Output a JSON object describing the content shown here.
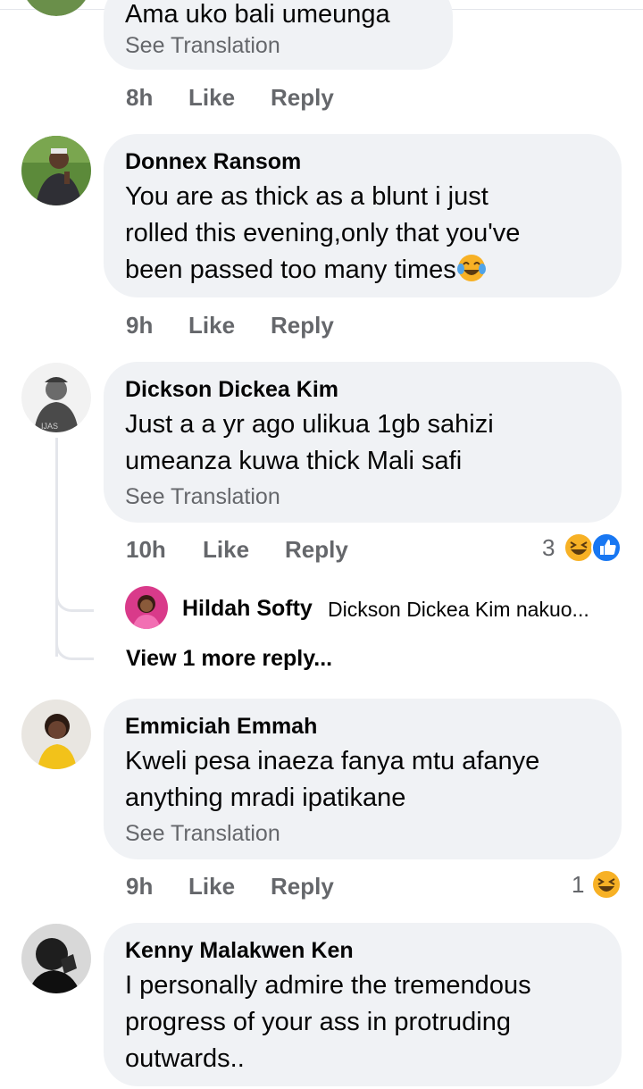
{
  "comments": [
    {
      "text_lines": [
        "Ama uko bali umeunga"
      ],
      "see_translation": "See Translation",
      "time": "8h",
      "like": "Like",
      "reply": "Reply"
    },
    {
      "name": "Donnex Ransom",
      "text_lines": [
        "You are as thick as a blunt i just",
        "rolled this evening,only that you've",
        "been passed too many times"
      ],
      "time": "9h",
      "like": "Like",
      "reply": "Reply"
    },
    {
      "name": "Dickson Dickea Kim",
      "text_lines": [
        "Just a a yr ago  ulikua 1gb sahizi",
        "umeanza kuwa thick   Mali safi"
      ],
      "see_translation": "See Translation",
      "time": "10h",
      "like": "Like",
      "reply": "Reply",
      "reaction_count": "3",
      "reactions": [
        "haha-icon",
        "like-icon"
      ],
      "replies_preview": {
        "name": "Hildah Softy",
        "text": "Dickson Dickea Kim nakuo...",
        "view_more": "View 1 more reply..."
      }
    },
    {
      "name": "Emmiciah Emmah",
      "text_lines": [
        "Kweli pesa inaeza fanya mtu afanye",
        "anything mradi ipatikane"
      ],
      "see_translation": "See Translation",
      "time": "9h",
      "like": "Like",
      "reply": "Reply",
      "reaction_count": "1",
      "reactions": [
        "haha-icon"
      ]
    },
    {
      "name": "Kenny Malakwen Ken",
      "text_lines": [
        "I personally admire the tremendous",
        "progress of your ass in protruding",
        "outwards.."
      ]
    }
  ],
  "colors": {
    "bubble": "#f0f2f5",
    "meta_text": "#65676b",
    "like_blue": "#1877f2",
    "haha_yellow": "#f7b125"
  }
}
